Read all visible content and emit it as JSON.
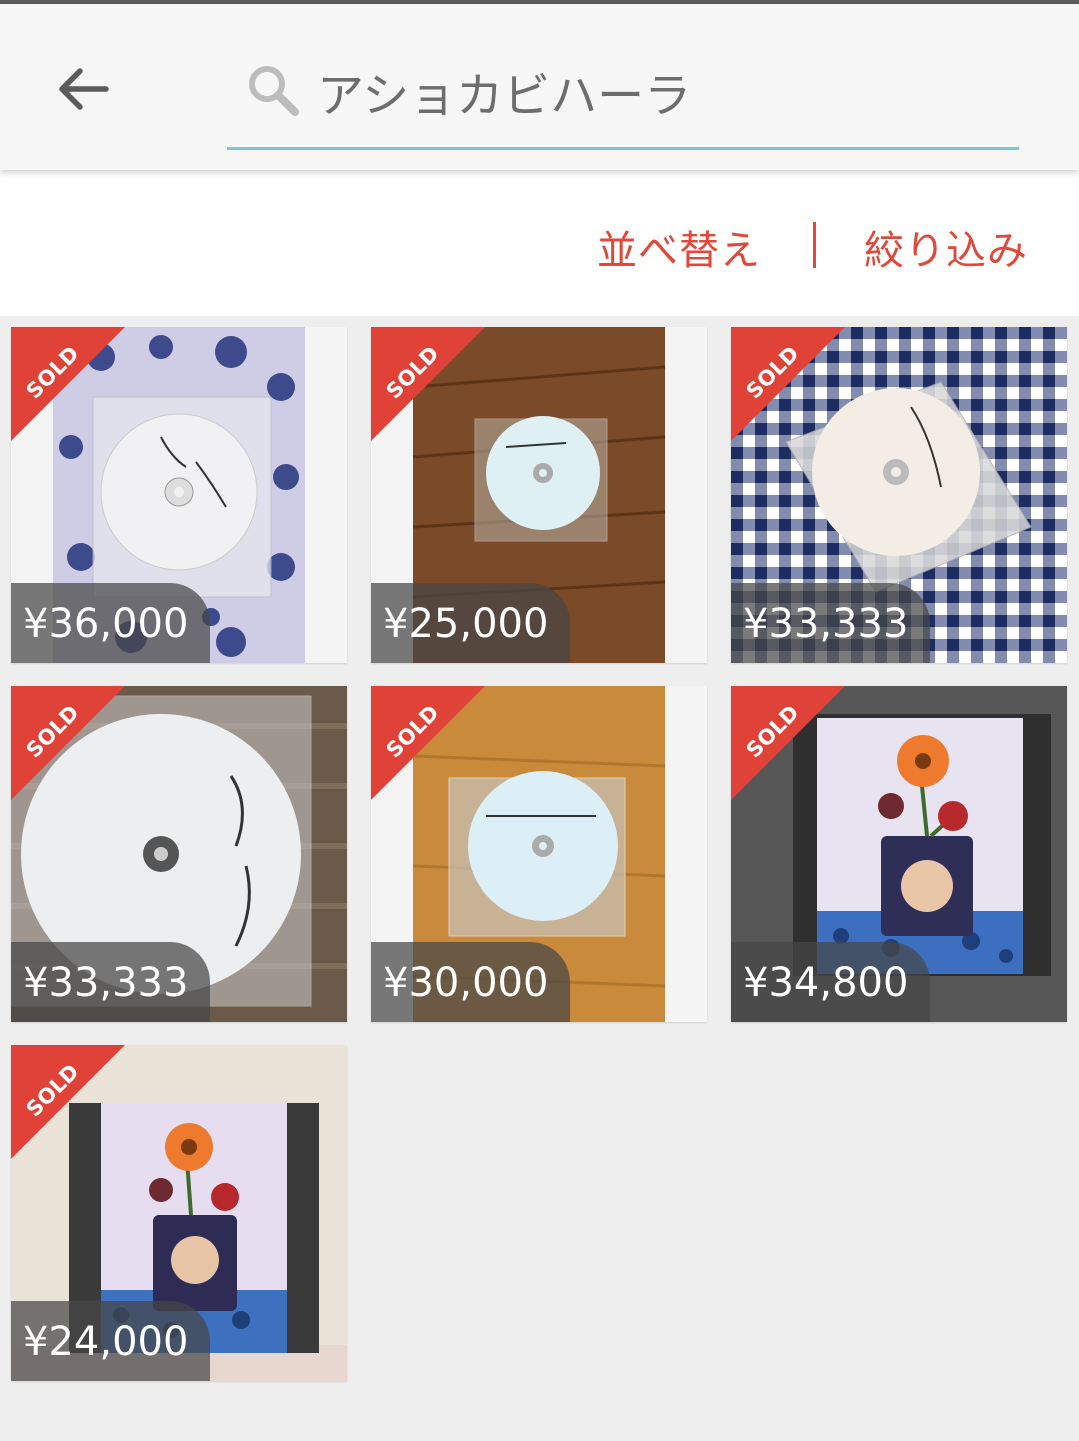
{
  "header": {
    "search": {
      "value": "アショカビハーラ"
    }
  },
  "toolbar": {
    "sort_label": "並べ替え",
    "filter_label": "絞り込み"
  },
  "items": [
    {
      "price": "¥36,000",
      "status": "SOLD"
    },
    {
      "price": "¥25,000",
      "status": "SOLD"
    },
    {
      "price": "¥33,333",
      "status": "SOLD"
    },
    {
      "price": "¥33,333",
      "status": "SOLD"
    },
    {
      "price": "¥30,000",
      "status": "SOLD"
    },
    {
      "price": "¥34,800",
      "status": "SOLD"
    },
    {
      "price": "¥24,000",
      "status": "SOLD"
    }
  ],
  "colors": {
    "accent": "#e0493a",
    "search_underline": "#7ec8cf",
    "sold_red": "#e04237"
  },
  "icons": {
    "back": "arrow-left-icon",
    "search": "search-icon"
  }
}
